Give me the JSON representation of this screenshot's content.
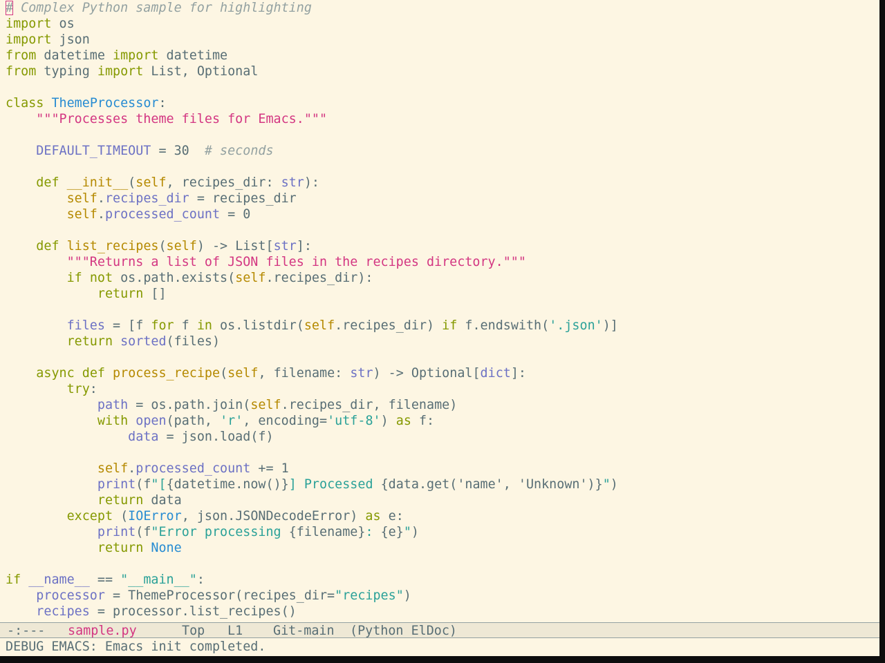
{
  "editor": {
    "app": "Emacs",
    "theme_colors": {
      "background": "#fdf6e3",
      "keyword": "#859900",
      "comment": "#93a1a1",
      "string": "#d33682",
      "string_alt": "#2aa198",
      "type": "#268bd2",
      "variable": "#6c71c4",
      "builtin": "#b58900"
    },
    "lines": [
      [
        {
          "t": "#",
          "c": "cursor"
        },
        {
          "t": " Complex Python sample for highlighting",
          "c": "cm"
        }
      ],
      [
        {
          "t": "import",
          "c": "kw"
        },
        {
          "t": " os",
          "c": "id"
        }
      ],
      [
        {
          "t": "import",
          "c": "kw"
        },
        {
          "t": " json",
          "c": "id"
        }
      ],
      [
        {
          "t": "from",
          "c": "kw"
        },
        {
          "t": " datetime ",
          "c": "id"
        },
        {
          "t": "import",
          "c": "kw"
        },
        {
          "t": " datetime",
          "c": "id"
        }
      ],
      [
        {
          "t": "from",
          "c": "kw"
        },
        {
          "t": " typing ",
          "c": "id"
        },
        {
          "t": "import",
          "c": "kw"
        },
        {
          "t": " List, Optional",
          "c": "id"
        }
      ],
      [],
      [
        {
          "t": "class",
          "c": "kw"
        },
        {
          "t": " ",
          "c": "id"
        },
        {
          "t": "ThemeProcessor",
          "c": "type"
        },
        {
          "t": ":",
          "c": "id"
        }
      ],
      [
        {
          "t": "    ",
          "c": "id"
        },
        {
          "t": "\"\"\"Processes theme files for Emacs.\"\"\"",
          "c": "str"
        }
      ],
      [],
      [
        {
          "t": "    ",
          "c": "id"
        },
        {
          "t": "DEFAULT_TIMEOUT",
          "c": "var"
        },
        {
          "t": " = 30  ",
          "c": "id"
        },
        {
          "t": "# seconds",
          "c": "cm"
        }
      ],
      [],
      [
        {
          "t": "    ",
          "c": "id"
        },
        {
          "t": "def",
          "c": "kw"
        },
        {
          "t": " ",
          "c": "id"
        },
        {
          "t": "__init__",
          "c": "fn"
        },
        {
          "t": "(",
          "c": "id"
        },
        {
          "t": "self",
          "c": "bi"
        },
        {
          "t": ", recipes_dir: ",
          "c": "id"
        },
        {
          "t": "str",
          "c": "var"
        },
        {
          "t": "):",
          "c": "id"
        }
      ],
      [
        {
          "t": "        ",
          "c": "id"
        },
        {
          "t": "self",
          "c": "bi"
        },
        {
          "t": ".",
          "c": "id"
        },
        {
          "t": "recipes_dir",
          "c": "var"
        },
        {
          "t": " = recipes_dir",
          "c": "id"
        }
      ],
      [
        {
          "t": "        ",
          "c": "id"
        },
        {
          "t": "self",
          "c": "bi"
        },
        {
          "t": ".",
          "c": "id"
        },
        {
          "t": "processed_count",
          "c": "var"
        },
        {
          "t": " = 0",
          "c": "id"
        }
      ],
      [],
      [
        {
          "t": "    ",
          "c": "id"
        },
        {
          "t": "def",
          "c": "kw"
        },
        {
          "t": " ",
          "c": "id"
        },
        {
          "t": "list_recipes",
          "c": "fn"
        },
        {
          "t": "(",
          "c": "id"
        },
        {
          "t": "self",
          "c": "bi"
        },
        {
          "t": ") -> List[",
          "c": "id"
        },
        {
          "t": "str",
          "c": "var"
        },
        {
          "t": "]:",
          "c": "id"
        }
      ],
      [
        {
          "t": "        ",
          "c": "id"
        },
        {
          "t": "\"\"\"Returns a list of JSON files in the recipes directory.\"\"\"",
          "c": "str"
        }
      ],
      [
        {
          "t": "        ",
          "c": "id"
        },
        {
          "t": "if",
          "c": "kw"
        },
        {
          "t": " ",
          "c": "id"
        },
        {
          "t": "not",
          "c": "kw"
        },
        {
          "t": " os.path.exists(",
          "c": "id"
        },
        {
          "t": "self",
          "c": "bi"
        },
        {
          "t": ".recipes_dir):",
          "c": "id"
        }
      ],
      [
        {
          "t": "            ",
          "c": "id"
        },
        {
          "t": "return",
          "c": "kw"
        },
        {
          "t": " []",
          "c": "id"
        }
      ],
      [],
      [
        {
          "t": "        ",
          "c": "id"
        },
        {
          "t": "files",
          "c": "var"
        },
        {
          "t": " = [f ",
          "c": "id"
        },
        {
          "t": "for",
          "c": "kw"
        },
        {
          "t": " f ",
          "c": "id"
        },
        {
          "t": "in",
          "c": "kw"
        },
        {
          "t": " os.listdir(",
          "c": "id"
        },
        {
          "t": "self",
          "c": "bi"
        },
        {
          "t": ".recipes_dir) ",
          "c": "id"
        },
        {
          "t": "if",
          "c": "kw"
        },
        {
          "t": " f.endswith(",
          "c": "id"
        },
        {
          "t": "'.json'",
          "c": "str2"
        },
        {
          "t": ")]",
          "c": "id"
        }
      ],
      [
        {
          "t": "        ",
          "c": "id"
        },
        {
          "t": "return",
          "c": "kw"
        },
        {
          "t": " ",
          "c": "id"
        },
        {
          "t": "sorted",
          "c": "var"
        },
        {
          "t": "(files)",
          "c": "id"
        }
      ],
      [],
      [
        {
          "t": "    ",
          "c": "id"
        },
        {
          "t": "async",
          "c": "kw"
        },
        {
          "t": " ",
          "c": "id"
        },
        {
          "t": "def",
          "c": "kw"
        },
        {
          "t": " ",
          "c": "id"
        },
        {
          "t": "process_recipe",
          "c": "fn"
        },
        {
          "t": "(",
          "c": "id"
        },
        {
          "t": "self",
          "c": "bi"
        },
        {
          "t": ", filename: ",
          "c": "id"
        },
        {
          "t": "str",
          "c": "var"
        },
        {
          "t": ") -> Optional[",
          "c": "id"
        },
        {
          "t": "dict",
          "c": "var"
        },
        {
          "t": "]:",
          "c": "id"
        }
      ],
      [
        {
          "t": "        ",
          "c": "id"
        },
        {
          "t": "try",
          "c": "kw"
        },
        {
          "t": ":",
          "c": "id"
        }
      ],
      [
        {
          "t": "            ",
          "c": "id"
        },
        {
          "t": "path",
          "c": "var"
        },
        {
          "t": " = os.path.join(",
          "c": "id"
        },
        {
          "t": "self",
          "c": "bi"
        },
        {
          "t": ".recipes_dir, filename)",
          "c": "id"
        }
      ],
      [
        {
          "t": "            ",
          "c": "id"
        },
        {
          "t": "with",
          "c": "kw"
        },
        {
          "t": " ",
          "c": "id"
        },
        {
          "t": "open",
          "c": "var"
        },
        {
          "t": "(path, ",
          "c": "id"
        },
        {
          "t": "'r'",
          "c": "str2"
        },
        {
          "t": ", encoding=",
          "c": "id"
        },
        {
          "t": "'utf-8'",
          "c": "str2"
        },
        {
          "t": ") ",
          "c": "id"
        },
        {
          "t": "as",
          "c": "kw"
        },
        {
          "t": " f:",
          "c": "id"
        }
      ],
      [
        {
          "t": "                ",
          "c": "id"
        },
        {
          "t": "data",
          "c": "var"
        },
        {
          "t": " = json.load(f)",
          "c": "id"
        }
      ],
      [],
      [
        {
          "t": "            ",
          "c": "id"
        },
        {
          "t": "self",
          "c": "bi"
        },
        {
          "t": ".",
          "c": "id"
        },
        {
          "t": "processed_count",
          "c": "var"
        },
        {
          "t": " += 1",
          "c": "id"
        }
      ],
      [
        {
          "t": "            ",
          "c": "id"
        },
        {
          "t": "print",
          "c": "var"
        },
        {
          "t": "(f",
          "c": "id"
        },
        {
          "t": "\"[",
          "c": "str2"
        },
        {
          "t": "{datetime.now()}",
          "c": "id"
        },
        {
          "t": "] Processed ",
          "c": "str2"
        },
        {
          "t": "{data.get('name', 'Unknown')}",
          "c": "id"
        },
        {
          "t": "\"",
          "c": "str2"
        },
        {
          "t": ")",
          "c": "id"
        }
      ],
      [
        {
          "t": "            ",
          "c": "id"
        },
        {
          "t": "return",
          "c": "kw"
        },
        {
          "t": " data",
          "c": "id"
        }
      ],
      [
        {
          "t": "        ",
          "c": "id"
        },
        {
          "t": "except",
          "c": "kw"
        },
        {
          "t": " (",
          "c": "id"
        },
        {
          "t": "IOError",
          "c": "type"
        },
        {
          "t": ", json.JSONDecodeError) ",
          "c": "id"
        },
        {
          "t": "as",
          "c": "kw"
        },
        {
          "t": " e:",
          "c": "id"
        }
      ],
      [
        {
          "t": "            ",
          "c": "id"
        },
        {
          "t": "print",
          "c": "var"
        },
        {
          "t": "(f",
          "c": "id"
        },
        {
          "t": "\"Error processing ",
          "c": "str2"
        },
        {
          "t": "{filename}",
          "c": "id"
        },
        {
          "t": ": ",
          "c": "str2"
        },
        {
          "t": "{e}",
          "c": "id"
        },
        {
          "t": "\"",
          "c": "str2"
        },
        {
          "t": ")",
          "c": "id"
        }
      ],
      [
        {
          "t": "            ",
          "c": "id"
        },
        {
          "t": "return",
          "c": "kw"
        },
        {
          "t": " ",
          "c": "id"
        },
        {
          "t": "None",
          "c": "type"
        }
      ],
      [],
      [
        {
          "t": "if",
          "c": "kw"
        },
        {
          "t": " ",
          "c": "id"
        },
        {
          "t": "__name__",
          "c": "var"
        },
        {
          "t": " == ",
          "c": "id"
        },
        {
          "t": "\"__main__\"",
          "c": "str2"
        },
        {
          "t": ":",
          "c": "id"
        }
      ],
      [
        {
          "t": "    ",
          "c": "id"
        },
        {
          "t": "processor",
          "c": "var"
        },
        {
          "t": " = ThemeProcessor(recipes_dir=",
          "c": "id"
        },
        {
          "t": "\"recipes\"",
          "c": "str2"
        },
        {
          "t": ")",
          "c": "id"
        }
      ],
      [
        {
          "t": "    ",
          "c": "id"
        },
        {
          "t": "recipes",
          "c": "var"
        },
        {
          "t": " = processor.list_recipes()",
          "c": "id"
        }
      ]
    ]
  },
  "modeline": {
    "status": "-:---",
    "buffer_name": "sample.py",
    "position": "Top",
    "line": "L1",
    "vc": "Git-main",
    "modes": "(Python ElDoc)"
  },
  "minibuffer": {
    "message": "DEBUG EMACS: Emacs init completed."
  }
}
